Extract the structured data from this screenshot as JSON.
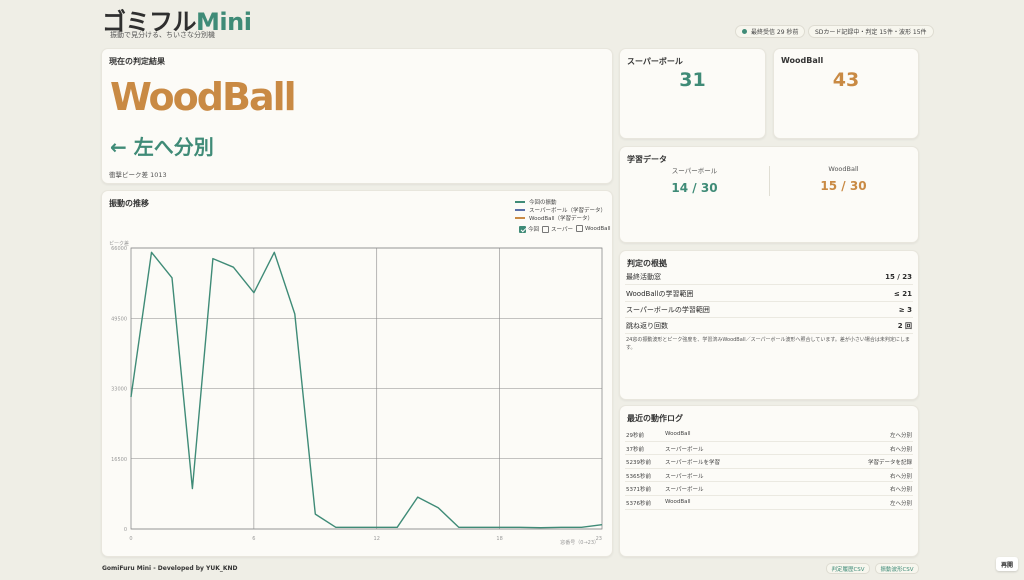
{
  "header": {
    "logo_main": "ゴミフル",
    "logo_accent": "Mini",
    "tagline": "振動で見分ける、ちいさな分別機",
    "status_received": "最終受信 29 秒前",
    "status_sd": "SDカード記録中・判定 15件・波形 15件"
  },
  "result": {
    "title": "現在の判定結果",
    "name": "WoodBall",
    "direction": "← 左へ分別",
    "peak": "衝撃ピーク差 1013"
  },
  "counts": [
    {
      "label": "スーパーボール",
      "value": "31",
      "color": "#3f8b77"
    },
    {
      "label": "WoodBall",
      "value": "43",
      "color": "#c98a44"
    }
  ],
  "learning": {
    "title": "学習データ",
    "super_label": "スーパーボール",
    "super_value": "14 / 30",
    "wood_label": "WoodBall",
    "wood_value": "15 / 30"
  },
  "basis": {
    "title": "判定の根拠",
    "rows": [
      {
        "label": "最終活動窓",
        "value": "15 / 23"
      },
      {
        "label": "WoodBallの学習範囲",
        "value": "≤ 21"
      },
      {
        "label": "スーパーボールの学習範囲",
        "value": "≥ 3"
      },
      {
        "label": "跳ね返り回数",
        "value": "2 回"
      }
    ],
    "note": "24窓の振動波形とピーク強度を、学習済みWoodBall／スーパーボール波形へ照合しています。差が小さい場合は未判定にします。"
  },
  "log": {
    "title": "最近の動作ログ",
    "rows": [
      {
        "time": "29秒前",
        "item": "WoodBall",
        "action": "左へ分別"
      },
      {
        "time": "37秒前",
        "item": "スーパーボール",
        "action": "右へ分別"
      },
      {
        "time": "5239秒前",
        "item": "スーパーボールを学習",
        "action": "学習データを記録"
      },
      {
        "time": "5365秒前",
        "item": "スーパーボール",
        "action": "右へ分別"
      },
      {
        "time": "5371秒前",
        "item": "スーパーボール",
        "action": "右へ分別"
      },
      {
        "time": "5376秒前",
        "item": "WoodBall",
        "action": "左へ分別"
      }
    ]
  },
  "chart_panel": {
    "title": "振動の推移",
    "legend_current": "今回の振動",
    "legend_super": "スーパーボール（学習データ）",
    "legend_wood": "WoodBall（学習データ）",
    "cb_current": "今回",
    "cb_super": "スーパー",
    "cb_wood": "WoodBall"
  },
  "chart_data": {
    "type": "line",
    "ylabel": "ピーク差",
    "xlabel": "窓番号（0→23）",
    "xlim": [
      0,
      23
    ],
    "ylim": [
      0,
      66000
    ],
    "x_ticks": [
      "0",
      "6",
      "12",
      "18",
      "23"
    ],
    "y_ticks": [
      "0",
      "16500",
      "33000",
      "49500",
      "66000"
    ],
    "colors": {
      "current": "#3f8b77",
      "super": "#5a6fa8",
      "wood": "#c98a44"
    },
    "series": [
      {
        "name": "今回の振動",
        "x": [
          0,
          1,
          2,
          3,
          4,
          5,
          6,
          7,
          8,
          9,
          10,
          11,
          12,
          13,
          14,
          15,
          16,
          17,
          18,
          19,
          20,
          21,
          22,
          23
        ],
        "values": [
          31000,
          65000,
          59000,
          9500,
          63500,
          61500,
          55500,
          65000,
          50500,
          3500,
          400,
          400,
          400,
          400,
          7500,
          5000,
          400,
          400,
          400,
          400,
          300,
          400,
          400,
          1000
        ]
      }
    ]
  },
  "footer": {
    "credit": "GomiFuru Mini - Developed by YUK_KND",
    "btn_history": "判定履歴CSV",
    "btn_wave": "振動波形CSV",
    "replay": "再開"
  }
}
